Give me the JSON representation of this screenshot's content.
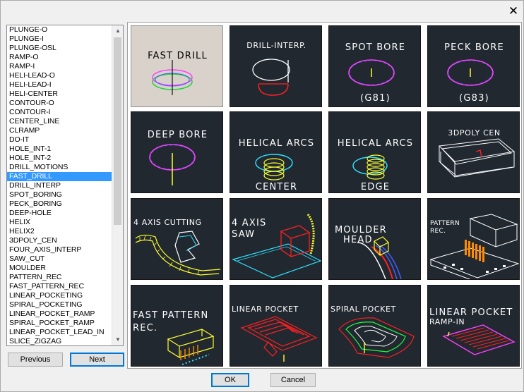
{
  "dialog": {
    "close_symbol": "✕"
  },
  "list": {
    "items": [
      "PLUNGE-O",
      "PLUNGE-I",
      "PLUNGE-OSL",
      "RAMP-O",
      "RAMP-I",
      "HELI-LEAD-O",
      "HELI-LEAD-I",
      "HELI-CENTER",
      "CONTOUR-O",
      "CONTOUR-I",
      "CENTER_LINE",
      "CLRAMP",
      "DO-IT",
      "HOLE_INT-1",
      "HOLE_INT-2",
      "DRILL_MOTIONS",
      "FAST_DRILL",
      "DRILL_INTERP",
      "SPOT_BORING",
      "PECK_BORING",
      "DEEP-HOLE",
      "HELIX",
      "HELIX2",
      "3DPOLY_CEN",
      "FOUR_AXIS_INTERP",
      "SAW_CUT",
      "MOULDER",
      "PATTERN_REC",
      "FAST_PATTERN_REC",
      "LINEAR_POCKETING",
      "SPIRAL_POCKETING",
      "LINEAR_POCKET_RAMP",
      "SPIRAL_POCKET_RAMP",
      "LINEAR_POCKET_LEAD_IN",
      "SLICE_ZIGZAG"
    ],
    "selected_index": 16
  },
  "buttons": {
    "previous": "Previous",
    "next": "Next",
    "ok": "OK",
    "cancel": "Cancel"
  },
  "tiles": {
    "fast_drill": "FAST DRILL",
    "drill_interp": "DRILL-INTERP.",
    "spot_bore": "SPOT BORE",
    "spot_bore_code": "(G81)",
    "peck_bore": "PECK BORE",
    "peck_bore_code": "(G83)",
    "deep_bore": "DEEP BORE",
    "helical_center_title": "HELICAL ARCS",
    "helical_center_sub": "CENTER",
    "helical_edge_title": "HELICAL ARCS",
    "helical_edge_sub": "EDGE",
    "poly_cen": "3DPOLY CEN",
    "four_axis_cutting": "4 AXIS CUTTING",
    "four_axis_saw_1": "4 AXIS",
    "four_axis_saw_2": "SAW",
    "moulder_1": "MOULDER",
    "moulder_2": "HEAD",
    "pattern_rec_1": "PATTERN",
    "pattern_rec_2": "REC.",
    "fast_pattern_1": "FAST PATTERN",
    "fast_pattern_2": "REC.",
    "linear_pocket": "LINEAR POCKET",
    "spiral_pocket": "SPIRAL POCKET",
    "linear_ramp_1": "LINEAR POCKET",
    "linear_ramp_2": "RAMP-IN"
  },
  "colors": {
    "selection": "#3399ff",
    "tile_bg": "#212830",
    "tile_selected_bg": "#d8d2ca",
    "magenta": "#ff40ff",
    "blue": "#4060ff",
    "yellow": "#ffff30",
    "red": "#ff2020",
    "cyan": "#30e0ff",
    "green": "#20ff40",
    "orange": "#ff8c00"
  }
}
